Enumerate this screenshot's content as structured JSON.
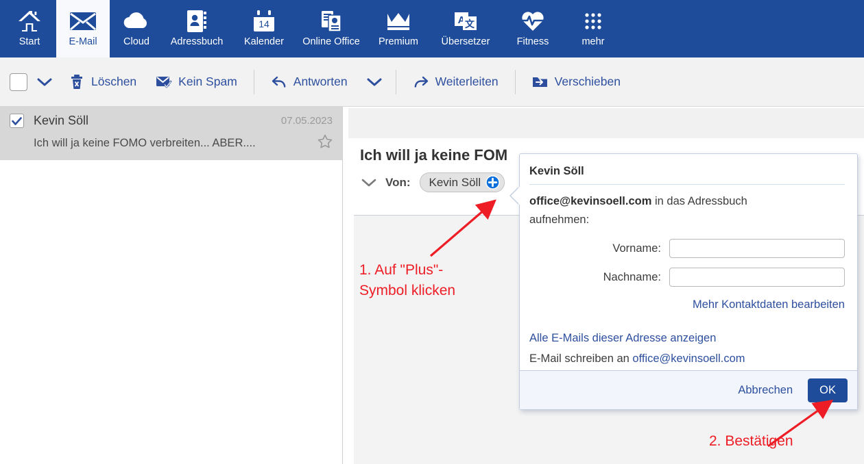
{
  "nav": {
    "items": [
      {
        "label": "Start",
        "icon": "home-icon",
        "active": false
      },
      {
        "label": "E-Mail",
        "icon": "envelope-icon",
        "active": true
      },
      {
        "label": "Cloud",
        "icon": "cloud-icon",
        "active": false
      },
      {
        "label": "Adressbuch",
        "icon": "address-book-icon",
        "active": false
      },
      {
        "label": "Kalender",
        "icon": "calendar-icon",
        "active": false
      },
      {
        "label": "Online Office",
        "icon": "documents-icon",
        "active": false
      },
      {
        "label": "Premium",
        "icon": "crown-icon",
        "active": false
      },
      {
        "label": "Übersetzer",
        "icon": "translate-icon",
        "active": false
      },
      {
        "label": "Fitness",
        "icon": "heart-pulse-icon",
        "active": false
      },
      {
        "label": "mehr",
        "icon": "grid-dots-icon",
        "active": false
      }
    ],
    "calendar_day": "14",
    "background": "#1e4c9a"
  },
  "toolbar": {
    "select_all_checked": false,
    "delete_label": "Löschen",
    "not_spam_label": "Kein Spam",
    "reply_label": "Antworten",
    "forward_label": "Weiterleiten",
    "move_label": "Verschieben"
  },
  "mail_list": {
    "rows": [
      {
        "checked": true,
        "sender": "Kevin Söll",
        "date": "07.05.2023",
        "subject": "Ich will ja keine FOMO verbreiten... ABER....",
        "starred": false
      }
    ]
  },
  "mail_detail": {
    "subject": "Ich will ja keine FOM",
    "from_label": "Von:",
    "sender_chip": "Kevin Söll",
    "add_contact_icon": "plus-circle-icon"
  },
  "popup": {
    "title": "Kevin Söll",
    "lead_email": "office@kevinsoell.com",
    "lead_rest": " in das Adressbuch aufnehmen:",
    "first_name_label": "Vorname:",
    "first_name_value": "",
    "last_name_label": "Nachname:",
    "last_name_value": "",
    "more_contact_link": "Mehr Kontaktdaten bearbeiten",
    "show_all_mails_link": "Alle E-Mails dieser Adresse anzeigen",
    "write_mail_prefix": "E-Mail schreiben an ",
    "write_mail_address": "office@kevinsoell.com",
    "cancel_label": "Abbrechen",
    "ok_label": "OK",
    "accent": "#1e4c9a"
  },
  "annotations": {
    "color": "#ee1c24",
    "step1": "1. Auf \"Plus\"-\nSymbol klicken",
    "step2": "2. Bestätigen"
  }
}
